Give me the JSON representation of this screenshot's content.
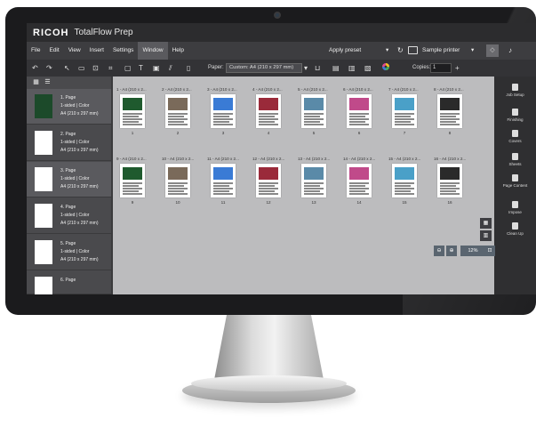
{
  "app": {
    "brand": "RICOH",
    "product": "TotalFlow Prep"
  },
  "menu": [
    "File",
    "Edit",
    "View",
    "Insert",
    "Settings",
    "Window",
    "Help"
  ],
  "menu_active": "Window",
  "topbar": {
    "apply_preset": "Apply preset",
    "printer": "Sample printer"
  },
  "toolbar": {
    "paper_label": "Paper:",
    "paper_value": "Custom: A4 (210 x 297 mm)",
    "copies_label": "Copies:",
    "copies_value": "1"
  },
  "sidebar": {
    "items": [
      {
        "title": "1. Page",
        "sides": "",
        "size": "A4 (210 x 297 mm)"
      },
      {
        "title": "2. Page",
        "sides": "1-sided | Color",
        "size": "A4 (210 x 297 mm)"
      },
      {
        "title": "3. Page",
        "sides": "1-sided | Color",
        "size": "A4 (210 x 297 mm)"
      },
      {
        "title": "4. Page",
        "sides": "1-sided | Color",
        "size": "A4 (210 x 297 mm)"
      },
      {
        "title": "5. Page",
        "sides": "1-sided | Color",
        "size": "A4 (210 x 297 mm)"
      },
      {
        "title": "6. Page",
        "sides": "",
        "size": ""
      }
    ],
    "first_sides": "1-sided | Color"
  },
  "pages_row1": [
    {
      "label": "1 - A4 (210 x 2...",
      "num": "1"
    },
    {
      "label": "2 - A4 (210 x 2...",
      "num": "2"
    },
    {
      "label": "3 - A4 (210 x 2...",
      "num": "3"
    },
    {
      "label": "4 - A4 (210 x 2...",
      "num": "4"
    },
    {
      "label": "5 - A4 (210 x 2...",
      "num": "5"
    },
    {
      "label": "6 - A4 (210 x 2...",
      "num": "6"
    },
    {
      "label": "7 - A4 (210 x 2...",
      "num": "7"
    },
    {
      "label": "8 - A4 (210 x 2...",
      "num": "8"
    }
  ],
  "pages_row2": [
    {
      "label": "9 - A4 (210 x 2...",
      "num": "9"
    },
    {
      "label": "10 - A4 (210 x 2...",
      "num": "10"
    },
    {
      "label": "11 - A4 (210 x 2...",
      "num": "11"
    },
    {
      "label": "12 - A4 (210 x 2...",
      "num": "12"
    },
    {
      "label": "13 - A4 (210 x 2...",
      "num": "13"
    },
    {
      "label": "14 - A4 (210 x 2...",
      "num": "14"
    },
    {
      "label": "15 - A4 (210 x 2...",
      "num": "15"
    },
    {
      "label": "16 - A4 (210 x 2...",
      "num": "16"
    }
  ],
  "right_panel": [
    "Job Setup",
    "Finishing",
    "Covers",
    "Sheets",
    "Page Content",
    "Impose",
    "Clean Up"
  ],
  "zoom": {
    "value": "12%"
  },
  "colors": {
    "accent": "#3a7bd5",
    "screen_bg": "#bcbcbe"
  }
}
